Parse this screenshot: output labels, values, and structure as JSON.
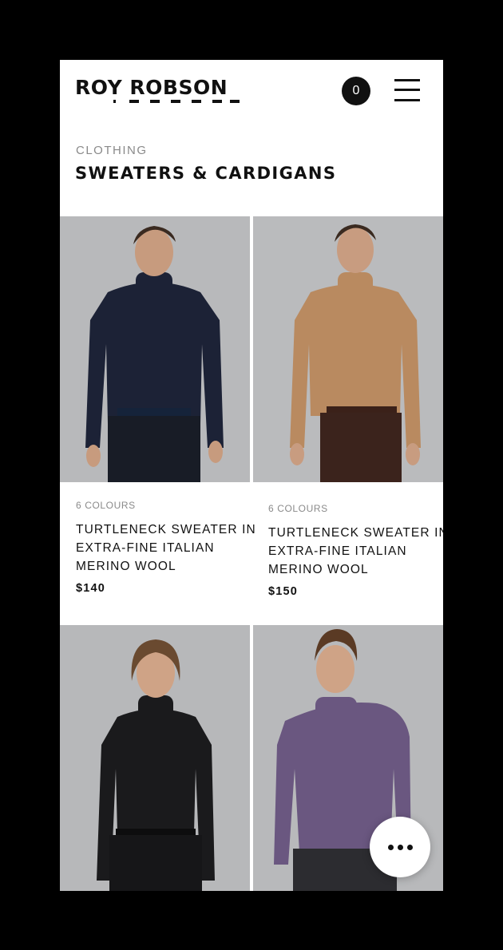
{
  "brand": {
    "name": "ROY ROBSON"
  },
  "header": {
    "cart_count": "0"
  },
  "page": {
    "breadcrumb": "CLOTHING",
    "title": "SWEATERS & CARDIGANS"
  },
  "products": [
    {
      "colours": "6 COLOURS",
      "name": "TURTLENECK SWEATER IN EXTRA-FINE ITALIAN MERINO WOOL",
      "price": "$140",
      "color": "#1c2236"
    },
    {
      "colours": "6 COLOURS",
      "name": "TURTLENECK SWEATER IN EXTRA-FINE ITALIAN MERINO WOOL",
      "price": "$150",
      "color": "#b98a60"
    },
    {
      "color": "#1a1a1c"
    },
    {
      "color": "#6a5780"
    }
  ],
  "icons": {
    "cart": "cart-count-badge",
    "menu": "hamburger-icon",
    "more": "more-dots-icon"
  }
}
